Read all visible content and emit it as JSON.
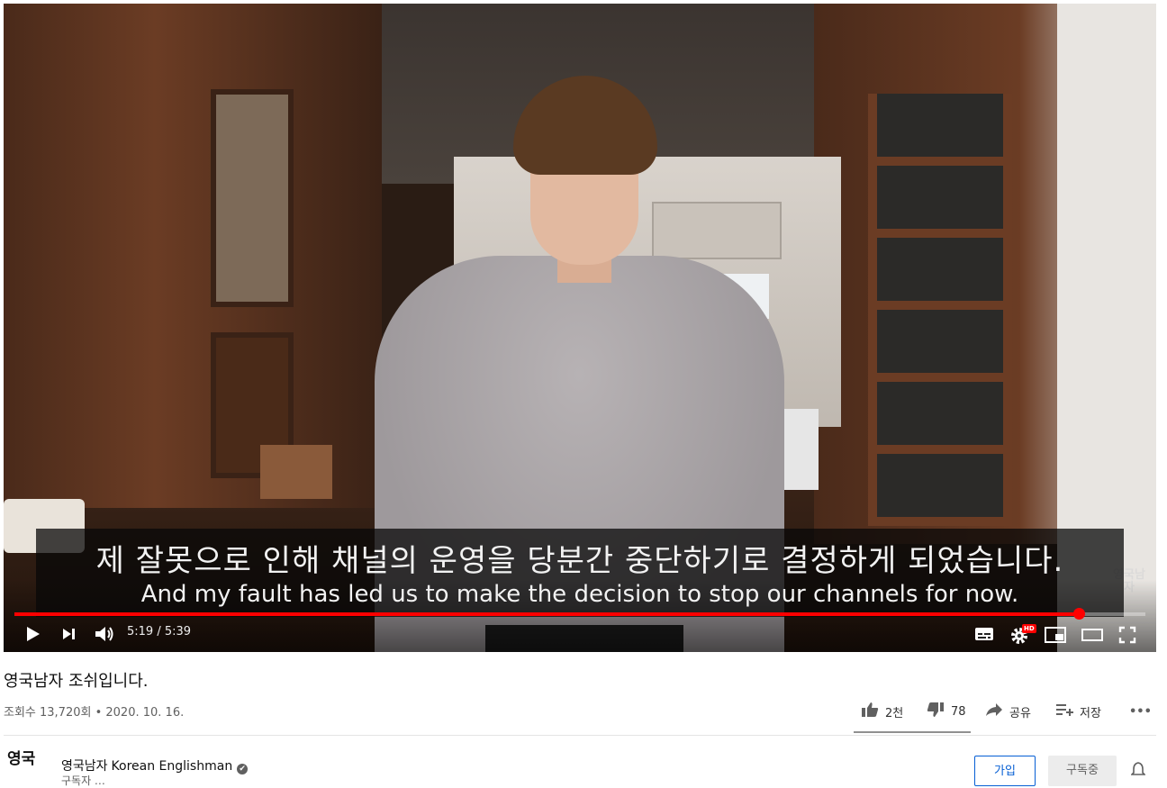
{
  "player": {
    "subtitle_ko": "제 잘못으로 인해 채널의 운영을 당분간 중단하기로 결정하게 되었습니다.",
    "subtitle_en": "And my fault has led us to make the decision to stop our channels for now.",
    "watermark": "영국남자",
    "time": "5:19 / 5:39",
    "progress": 0.941,
    "hd_badge": "HD",
    "accent": "#ff0000",
    "icons": [
      "play-icon",
      "next-icon",
      "volume-icon",
      "subtitles-icon",
      "settings-icon",
      "miniplayer-icon",
      "theater-icon",
      "fullscreen-icon"
    ]
  },
  "video": {
    "title": "영국남자 조쉬입니다.",
    "meta": "조회수 13,720회 • 2020. 10. 16.",
    "actions": {
      "like_count": "2천",
      "dislike_count": "78",
      "share_label": "공유",
      "save_label": "저장",
      "more_label": "•••"
    }
  },
  "channel": {
    "avatar_text": "영국",
    "name_ko": "영국남자",
    "name_en": "Korean Englishman",
    "verified": "✔",
    "subscribers": "구독자 …",
    "join_label": "가입",
    "subscribed_label": "구독중"
  }
}
